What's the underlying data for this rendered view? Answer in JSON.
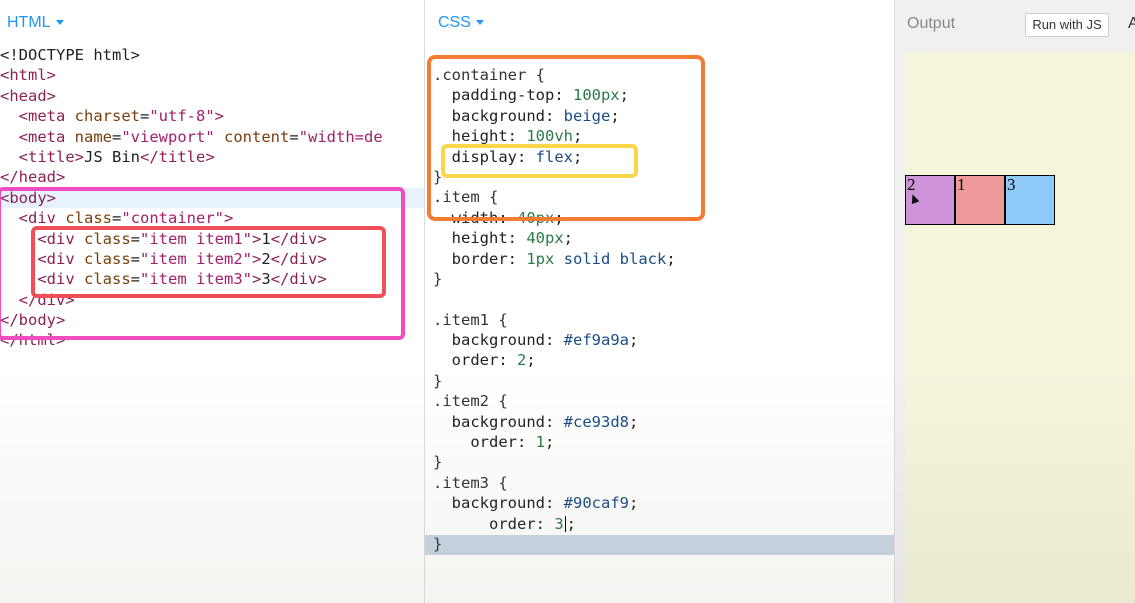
{
  "html_pane": {
    "title": "HTML",
    "lines": [
      [
        {
          "c": "txt",
          "t": "<!DOCTYPE html>"
        }
      ],
      [
        {
          "c": "tag",
          "t": "<html>"
        }
      ],
      [
        {
          "c": "tag",
          "t": "<head>"
        }
      ],
      [
        {
          "c": "txt",
          "t": "  "
        },
        {
          "c": "tag",
          "t": "<meta "
        },
        {
          "c": "attr",
          "t": "charset"
        },
        {
          "c": "txt",
          "t": "="
        },
        {
          "c": "str",
          "t": "\"utf-8\""
        },
        {
          "c": "tag",
          "t": ">"
        }
      ],
      [
        {
          "c": "txt",
          "t": "  "
        },
        {
          "c": "tag",
          "t": "<meta "
        },
        {
          "c": "attr",
          "t": "name"
        },
        {
          "c": "txt",
          "t": "="
        },
        {
          "c": "str",
          "t": "\"viewport\""
        },
        {
          "c": "txt",
          "t": " "
        },
        {
          "c": "attr",
          "t": "content"
        },
        {
          "c": "txt",
          "t": "="
        },
        {
          "c": "str",
          "t": "\"width=de"
        }
      ],
      [
        {
          "c": "txt",
          "t": "  "
        },
        {
          "c": "tag",
          "t": "<title>"
        },
        {
          "c": "txt",
          "t": "JS Bin"
        },
        {
          "c": "tag",
          "t": "</title>"
        }
      ],
      [
        {
          "c": "tag",
          "t": "</head>"
        }
      ],
      [
        {
          "c": "tag",
          "t": "<body>"
        }
      ],
      [
        {
          "c": "txt",
          "t": "  "
        },
        {
          "c": "tag",
          "t": "<div "
        },
        {
          "c": "attr",
          "t": "class"
        },
        {
          "c": "txt",
          "t": "="
        },
        {
          "c": "str",
          "t": "\"container\""
        },
        {
          "c": "tag",
          "t": ">"
        }
      ],
      [
        {
          "c": "txt",
          "t": "    "
        },
        {
          "c": "tag",
          "t": "<div "
        },
        {
          "c": "attr",
          "t": "class"
        },
        {
          "c": "txt",
          "t": "="
        },
        {
          "c": "str",
          "t": "\"item item1\""
        },
        {
          "c": "tag",
          "t": ">"
        },
        {
          "c": "txt",
          "t": "1"
        },
        {
          "c": "tag",
          "t": "</div>"
        }
      ],
      [
        {
          "c": "txt",
          "t": "    "
        },
        {
          "c": "tag",
          "t": "<div "
        },
        {
          "c": "attr",
          "t": "class"
        },
        {
          "c": "txt",
          "t": "="
        },
        {
          "c": "str",
          "t": "\"item item2\""
        },
        {
          "c": "tag",
          "t": ">"
        },
        {
          "c": "txt",
          "t": "2"
        },
        {
          "c": "tag",
          "t": "</div>"
        }
      ],
      [
        {
          "c": "txt",
          "t": "    "
        },
        {
          "c": "tag",
          "t": "<div "
        },
        {
          "c": "attr",
          "t": "class"
        },
        {
          "c": "txt",
          "t": "="
        },
        {
          "c": "str",
          "t": "\"item item3\""
        },
        {
          "c": "tag",
          "t": ">"
        },
        {
          "c": "txt",
          "t": "3"
        },
        {
          "c": "tag",
          "t": "</div>"
        }
      ],
      [
        {
          "c": "txt",
          "t": "  "
        },
        {
          "c": "tag",
          "t": "</div>"
        }
      ],
      [
        {
          "c": "tag",
          "t": "</body>"
        }
      ],
      [
        {
          "c": "tag",
          "t": "</html>"
        }
      ]
    ]
  },
  "css_pane": {
    "title": "CSS",
    "lines": [
      [
        {
          "c": "sel",
          "t": ".container {"
        }
      ],
      [
        {
          "c": "prop",
          "t": "  padding-top: "
        },
        {
          "c": "num",
          "t": "100px"
        },
        {
          "c": "txt",
          "t": ";"
        }
      ],
      [
        {
          "c": "prop",
          "t": "  background: "
        },
        {
          "c": "val",
          "t": "beige"
        },
        {
          "c": "txt",
          "t": ";"
        }
      ],
      [
        {
          "c": "prop",
          "t": "  height: "
        },
        {
          "c": "num",
          "t": "100vh"
        },
        {
          "c": "txt",
          "t": ";"
        }
      ],
      [
        {
          "c": "prop",
          "t": "  display: "
        },
        {
          "c": "val",
          "t": "flex"
        },
        {
          "c": "txt",
          "t": ";"
        }
      ],
      [
        {
          "c": "sel",
          "t": "}"
        }
      ],
      [
        {
          "c": "sel",
          "t": ".item {"
        }
      ],
      [
        {
          "c": "prop",
          "t": "  width: "
        },
        {
          "c": "num",
          "t": "40px"
        },
        {
          "c": "txt",
          "t": ";"
        }
      ],
      [
        {
          "c": "prop",
          "t": "  height: "
        },
        {
          "c": "num",
          "t": "40px"
        },
        {
          "c": "txt",
          "t": ";"
        }
      ],
      [
        {
          "c": "prop",
          "t": "  border: "
        },
        {
          "c": "num",
          "t": "1px"
        },
        {
          "c": "txt",
          "t": " "
        },
        {
          "c": "val",
          "t": "solid black"
        },
        {
          "c": "txt",
          "t": ";"
        }
      ],
      [
        {
          "c": "sel",
          "t": "}"
        }
      ],
      [
        {
          "c": "txt",
          "t": ""
        }
      ],
      [
        {
          "c": "sel",
          "t": ".item1 {"
        }
      ],
      [
        {
          "c": "prop",
          "t": "  background: "
        },
        {
          "c": "val",
          "t": "#ef9a9a"
        },
        {
          "c": "txt",
          "t": ";"
        }
      ],
      [
        {
          "c": "prop",
          "t": "  order: "
        },
        {
          "c": "num",
          "t": "2"
        },
        {
          "c": "txt",
          "t": ";"
        }
      ],
      [
        {
          "c": "sel",
          "t": "}"
        }
      ],
      [
        {
          "c": "sel",
          "t": ".item2 {"
        }
      ],
      [
        {
          "c": "prop",
          "t": "  background: "
        },
        {
          "c": "val",
          "t": "#ce93d8"
        },
        {
          "c": "txt",
          "t": ";"
        }
      ],
      [
        {
          "c": "prop",
          "t": "    order: "
        },
        {
          "c": "num",
          "t": "1"
        },
        {
          "c": "txt",
          "t": ";"
        }
      ],
      [
        {
          "c": "sel",
          "t": "}"
        }
      ],
      [
        {
          "c": "sel",
          "t": ".item3 {"
        }
      ],
      [
        {
          "c": "prop",
          "t": "  background: "
        },
        {
          "c": "val",
          "t": "#90caf9"
        },
        {
          "c": "txt",
          "t": ";"
        }
      ],
      [
        {
          "c": "prop",
          "t": "      order: "
        },
        {
          "c": "num",
          "t": "3"
        },
        {
          "c": "txt",
          "t": ";"
        }
      ],
      [
        {
          "c": "sel",
          "t": "}"
        }
      ]
    ]
  },
  "output_pane": {
    "title": "Output",
    "run_button": "Run with JS",
    "edge_char": "A",
    "background": "#f5f5dc",
    "items": [
      {
        "label": "2",
        "color": "#ce93d8"
      },
      {
        "label": "1",
        "color": "#ef9a9a"
      },
      {
        "label": "3",
        "color": "#90caf9"
      }
    ]
  },
  "colors": {
    "accent": "#2196f3",
    "annotation_pink": "#f04ec0",
    "annotation_red": "#ef4f56",
    "annotation_orange": "#f37b32",
    "annotation_yellow": "#fbd64b"
  }
}
